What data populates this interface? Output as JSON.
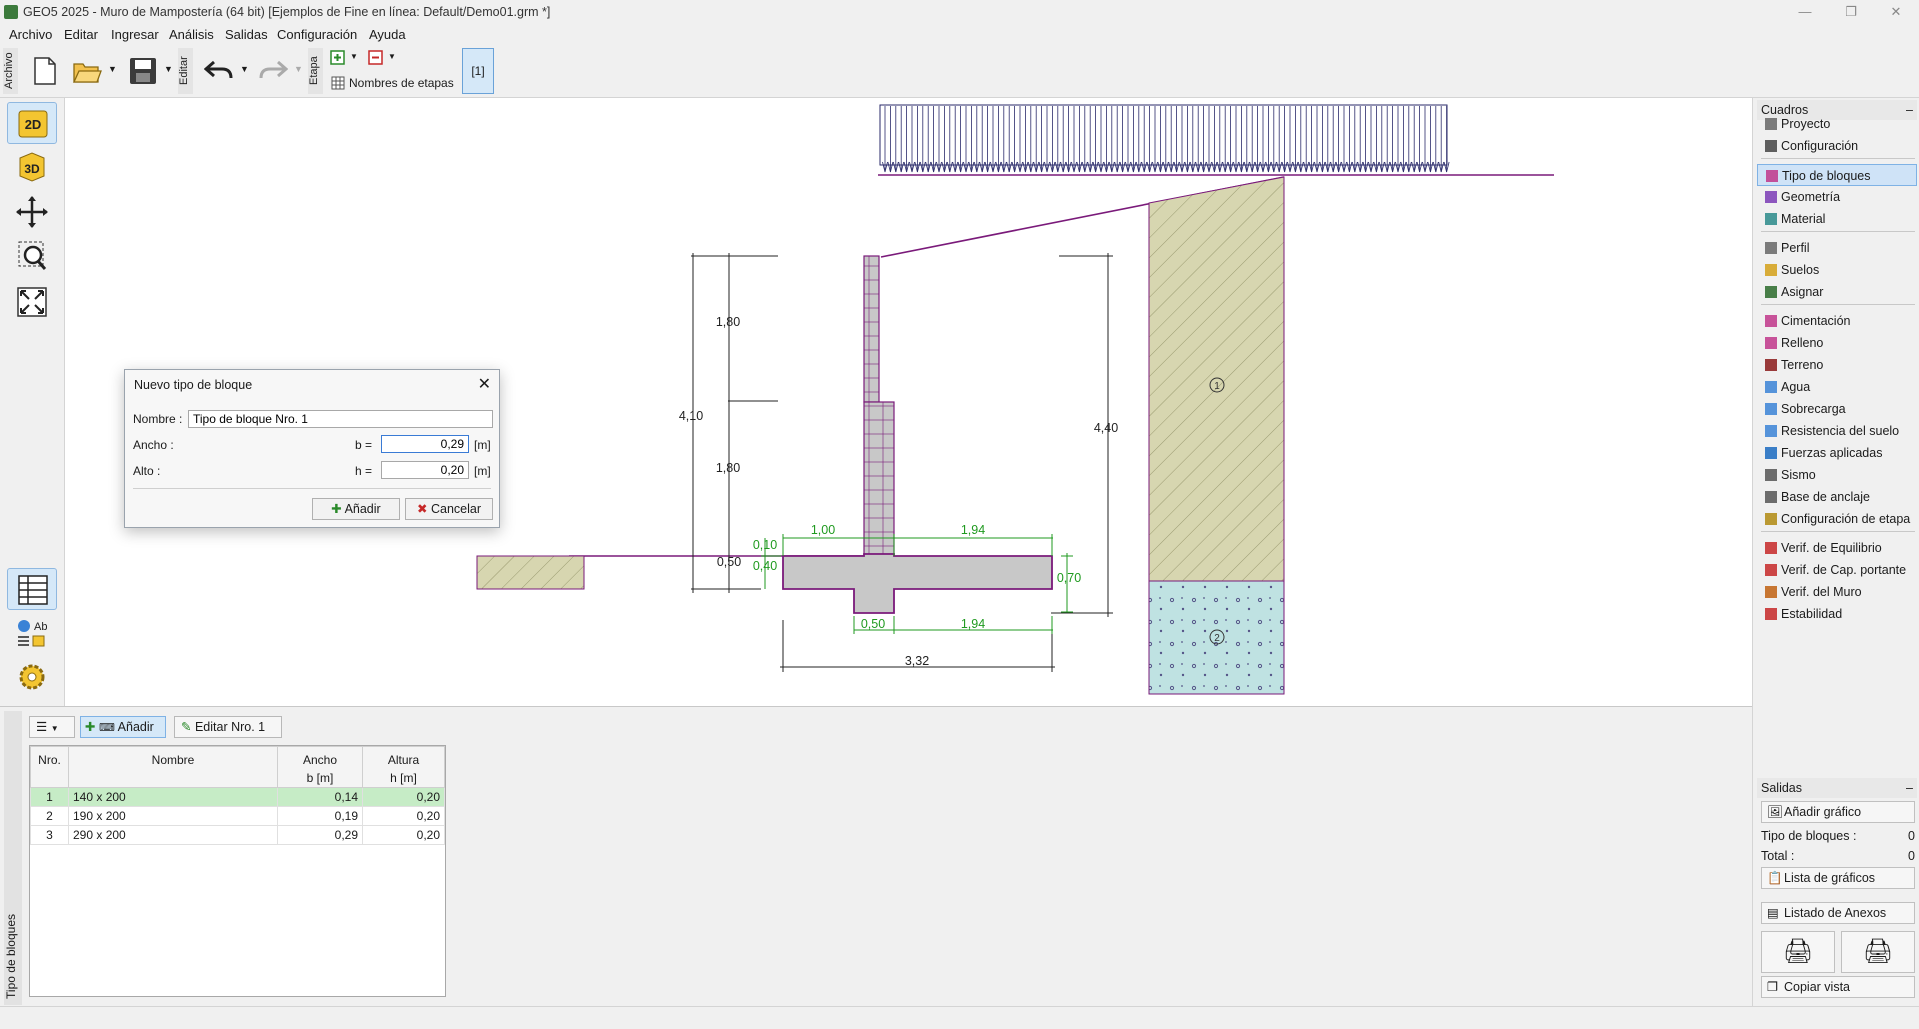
{
  "window": {
    "title": "GEO5 2025 - Muro de Mampostería (64 bit) [Ejemplos de Fine en línea: Default/Demo01.grm *]"
  },
  "menu": [
    "Archivo",
    "Editar",
    "Ingresar",
    "Análisis",
    "Salidas",
    "Configuración",
    "Ayuda"
  ],
  "toolbar": {
    "archivo_tab": "Archivo",
    "editar_tab": "Editar",
    "etapa_tab": "Etapa",
    "stage_names_label": "Nombres de etapas",
    "stage_indicator": "[1]"
  },
  "drawing": {
    "dims": {
      "d180_top": "1,80",
      "d180_bottom": "1,80",
      "d410": "4,10",
      "d440": "4,40",
      "d010": "0,10",
      "d050": "0,50",
      "d040": "0,40",
      "d100": "1,00",
      "d194_top": "1,94",
      "d070": "0,70",
      "d050_heel": "0,50",
      "d194_bottom": "1,94",
      "d332": "3,32"
    },
    "soil_layers": [
      "1",
      "2"
    ],
    "colors": {
      "soil1": "#d7d6b0",
      "soil2": "#bfe2e2",
      "wall": "#c8c8c8",
      "outline": "#7a1a7a",
      "dim_green": "#1f9a1f"
    }
  },
  "dialog": {
    "title": "Nuevo tipo de bloque",
    "nombre_label": "Nombre :",
    "nombre_value": "Tipo de bloque Nro. 1",
    "ancho_label": "Ancho :",
    "ancho_sym": "b  =",
    "ancho_value": "0,29",
    "alto_label": "Alto :",
    "alto_sym": "h  =",
    "alto_value": "0,20",
    "unit": "[m]",
    "add_label": "Añadir",
    "cancel_label": "Cancelar"
  },
  "bottom": {
    "side_label": "Tipo de bloques",
    "add_label": "Añadir",
    "edit_label": "Editar Nro. 1",
    "columns": [
      {
        "top": "Nro.",
        "bottom": ""
      },
      {
        "top": "Nombre",
        "bottom": ""
      },
      {
        "top": "Ancho",
        "bottom": "b  [m]"
      },
      {
        "top": "Altura",
        "bottom": "h  [m]"
      }
    ],
    "rows": [
      {
        "nro": "1",
        "nombre": "140 x 200",
        "ancho": "0,14",
        "altura": "0,20"
      },
      {
        "nro": "2",
        "nombre": "190 x 200",
        "ancho": "0,19",
        "altura": "0,20"
      },
      {
        "nro": "3",
        "nombre": "290 x 200",
        "ancho": "0,29",
        "altura": "0,20"
      }
    ]
  },
  "right_panel": {
    "cuadros_title": "Cuadros",
    "items": [
      {
        "label": "Proyecto",
        "icon": "document-icon"
      },
      {
        "label": "Configuración",
        "icon": "gear-icon"
      },
      {
        "label": "Tipo de bloques",
        "icon": "block-type-icon"
      },
      {
        "label": "Geometría",
        "icon": "geometry-icon"
      },
      {
        "label": "Material",
        "icon": "material-icon"
      },
      {
        "label": "Perfil",
        "icon": "profile-icon"
      },
      {
        "label": "Suelos",
        "icon": "soils-icon"
      },
      {
        "label": "Asignar",
        "icon": "assign-icon"
      },
      {
        "label": "Cimentación",
        "icon": "foundation-icon"
      },
      {
        "label": "Relleno",
        "icon": "backfill-icon"
      },
      {
        "label": "Terreno",
        "icon": "terrain-icon"
      },
      {
        "label": "Agua",
        "icon": "water-icon"
      },
      {
        "label": "Sobrecarga",
        "icon": "surcharge-icon"
      },
      {
        "label": "Resistencia del suelo",
        "icon": "resistance-icon"
      },
      {
        "label": "Fuerzas aplicadas",
        "icon": "forces-icon"
      },
      {
        "label": "Sismo",
        "icon": "earthquake-icon"
      },
      {
        "label": "Base de anclaje",
        "icon": "anchor-icon"
      },
      {
        "label": "Configuración de etapa",
        "icon": "stage-settings-icon"
      },
      {
        "label": "Verif. de Equilibrio",
        "icon": "equilibrium-icon"
      },
      {
        "label": "Verif. de Cap. portante",
        "icon": "bearing-icon"
      },
      {
        "label": "Verif. del Muro",
        "icon": "wall-check-icon"
      },
      {
        "label": "Estabilidad",
        "icon": "stability-icon"
      }
    ],
    "salidas_title": "Salidas",
    "add_graph": "Añadir gráfico",
    "tipo_bloques_label": "Tipo de bloques :",
    "tipo_bloques_value": "0",
    "total_label": "Total :",
    "total_value": "0",
    "graph_list": "Lista de gráficos",
    "annex_list": "Listado de Anexos",
    "copy_view": "Copiar vista"
  }
}
